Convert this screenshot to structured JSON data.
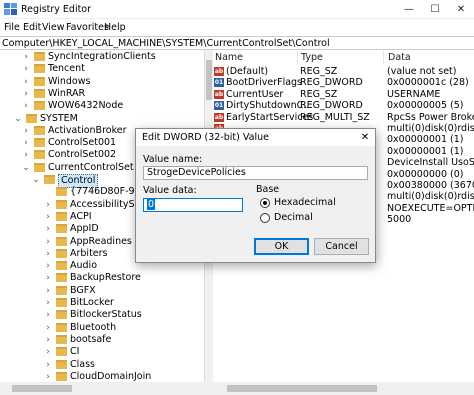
{
  "window": {
    "title": "Registry Editor",
    "minimize": "—",
    "maximize": "☐",
    "close": "✕"
  },
  "menu": [
    "File",
    "Edit",
    "View",
    "Favorites",
    "Help"
  ],
  "address": "Computer\\HKEY_LOCAL_MACHINE\\SYSTEM\\CurrentControlSet\\Control",
  "tree": {
    "items": [
      {
        "label": "SyncIntegrationClients",
        "chev": "›"
      },
      {
        "label": "Tencent",
        "chev": "›"
      },
      {
        "label": "Windows",
        "chev": "›"
      },
      {
        "label": "WinRAR",
        "chev": "›"
      },
      {
        "label": "WOW6432Node",
        "chev": "›"
      },
      {
        "label": "SYSTEM",
        "chev": "⌄"
      },
      {
        "label": "ActivationBroker",
        "chev": "›"
      },
      {
        "label": "ControlSet001",
        "chev": "›"
      },
      {
        "label": "ControlSet002",
        "chev": "›"
      },
      {
        "label": "CurrentControlSet",
        "chev": "⌄"
      },
      {
        "label": "Control",
        "chev": "⌄"
      },
      {
        "label": "{7746D80F-97",
        "chev": ""
      },
      {
        "label": "AccessibilitySe",
        "chev": "›"
      },
      {
        "label": "ACPI",
        "chev": "›"
      },
      {
        "label": "AppID",
        "chev": "›"
      },
      {
        "label": "AppReadines",
        "chev": "›"
      },
      {
        "label": "Arbiters",
        "chev": "›"
      },
      {
        "label": "Audio",
        "chev": "›"
      },
      {
        "label": "BackupRestore",
        "chev": "›"
      },
      {
        "label": "BGFX",
        "chev": "›"
      },
      {
        "label": "BitLocker",
        "chev": "›"
      },
      {
        "label": "BitlockerStatus",
        "chev": "›"
      },
      {
        "label": "Bluetooth",
        "chev": "›"
      },
      {
        "label": "bootsafe",
        "chev": "›"
      },
      {
        "label": "CI",
        "chev": "›"
      },
      {
        "label": "Class",
        "chev": "›"
      },
      {
        "label": "CloudDomainJoin",
        "chev": "›"
      }
    ]
  },
  "values": {
    "headers": {
      "name": "Name",
      "type": "Type",
      "data": "Data"
    },
    "rows": [
      {
        "icon": "string-value-icon",
        "name": "(Default)",
        "type": "REG_SZ",
        "data": "(value not set)"
      },
      {
        "icon": "binary-value-icon",
        "name": "BootDriverFlags",
        "type": "REG_DWORD",
        "data": "0x0000001c (28)"
      },
      {
        "icon": "string-value-icon",
        "name": "CurrentUser",
        "type": "REG_SZ",
        "data": "USERNAME"
      },
      {
        "icon": "binary-value-icon",
        "name": "DirtyShutdownC...",
        "type": "REG_DWORD",
        "data": "0x00000005 (5)"
      },
      {
        "icon": "string-value-icon",
        "name": "EarlyStartServices",
        "type": "REG_MULTI_SZ",
        "data": "RpcSs Power BrokerInfr"
      },
      {
        "icon": "string-value-icon",
        "name": "",
        "type": "",
        "data": "multi(0)disk(0)rdisk(0)p"
      },
      {
        "icon": "",
        "name": "",
        "type": "",
        "data": "0x00000001 (1)"
      },
      {
        "icon": "",
        "name": "",
        "type": "",
        "data": "0x00000001 (1)"
      },
      {
        "icon": "",
        "name": "",
        "type": "",
        "data": "DeviceInstall UsoSvc gr"
      },
      {
        "icon": "",
        "name": "",
        "type": "",
        "data": "0x00000000 (0)"
      },
      {
        "icon": "",
        "name": "",
        "type": "",
        "data": "0x00380000 (3670016"
      },
      {
        "icon": "",
        "name": "",
        "type": "",
        "data": "multi(0)disk(0)rdisk(0)p"
      },
      {
        "icon": "",
        "name": "",
        "type": "",
        "data": " NOEXECUTE=OPTIN"
      },
      {
        "icon": "",
        "name": "",
        "type": "",
        "data": "5000"
      }
    ]
  },
  "dialog": {
    "title": "Edit DWORD (32-bit) Value",
    "close": "✕",
    "value_name_label": "Value name:",
    "value_name": "StrogeDevicePolicies",
    "value_data_label": "Value data:",
    "value_data": "0",
    "base_label": "Base",
    "hex_label": "Hexadecimal",
    "dec_label": "Decimal",
    "base_selected": "Hexadecimal",
    "ok": "OK",
    "cancel": "Cancel",
    "accent": "#0078d7"
  }
}
